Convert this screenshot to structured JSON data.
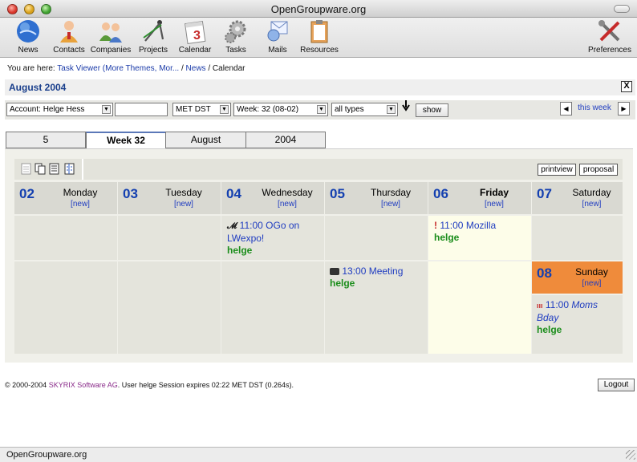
{
  "window": {
    "title": "OpenGroupware.org"
  },
  "toolbar": {
    "items": [
      {
        "label": "News",
        "icon": "news-globe-icon"
      },
      {
        "label": "Contacts",
        "icon": "contacts-person-icon"
      },
      {
        "label": "Companies",
        "icon": "companies-people-icon"
      },
      {
        "label": "Projects",
        "icon": "projects-compass-icon"
      },
      {
        "label": "Calendar",
        "icon": "calendar-icon"
      },
      {
        "label": "Tasks",
        "icon": "tasks-gears-icon"
      },
      {
        "label": "Mails",
        "icon": "mails-envelope-icon"
      },
      {
        "label": "Resources",
        "icon": "resources-clipboard-icon"
      }
    ],
    "preferences": {
      "label": "Preferences",
      "icon": "preferences-tools-icon"
    }
  },
  "breadcrumb": {
    "prefix": "You are here:",
    "link1": "Task Viewer (More Themes, Mor...",
    "sep": "/",
    "link2": "News",
    "current": "Calendar"
  },
  "section": {
    "title": "August 2004",
    "close": "X"
  },
  "filter": {
    "account": "Account: Helge Hess",
    "search_value": "",
    "timezone": "MET DST",
    "week": "Week: 32 (08-02)",
    "types": "all types",
    "show_label": "show",
    "this_week": "this week"
  },
  "tabs": [
    {
      "label": "5",
      "active": false
    },
    {
      "label": "Week 32",
      "active": true
    },
    {
      "label": "August",
      "active": false
    },
    {
      "label": "2004",
      "active": false
    }
  ],
  "view_buttons": {
    "printview": "printview",
    "proposal": "proposal"
  },
  "days": [
    {
      "num": "02",
      "name": "Monday",
      "new": "[new]"
    },
    {
      "num": "03",
      "name": "Tuesday",
      "new": "[new]"
    },
    {
      "num": "04",
      "name": "Wednesday",
      "new": "[new]"
    },
    {
      "num": "05",
      "name": "Thursday",
      "new": "[new]"
    },
    {
      "num": "06",
      "name": "Friday",
      "new": "[new]"
    },
    {
      "num": "07",
      "name": "Saturday",
      "new": "[new]"
    },
    {
      "num": "08",
      "name": "Sunday",
      "new": "[new]"
    }
  ],
  "events": {
    "wed": {
      "line1": "11:00 OGo on",
      "line2": "LWexpo!",
      "who": "helge",
      "icon": "news-m-icon"
    },
    "thu": {
      "line1": "13:00 Meeting",
      "who": "helge",
      "icon": "meeting-camera-icon"
    },
    "fri": {
      "line1": "11:00 Mozilla",
      "who": "helge",
      "icon": "exclamation-icon"
    },
    "sun": {
      "line1": "11:00",
      "line1b": "Moms",
      "line2": "Bday",
      "who": "helge",
      "icon": "birthday-candles-icon"
    }
  },
  "colors": {
    "day_number": "#1440b0",
    "owner": "#1b8d1b",
    "sunday_header": "#ef8b3b",
    "today_cell": "#fdfde9"
  },
  "footer": {
    "copyright_pre": "© 2000-2004",
    "company": "SKYRIX Software AG",
    "session": ". User helge Session expires 02:22 MET DST (0.264s).",
    "logout": "Logout"
  },
  "statusbar": {
    "text": "OpenGroupware.org"
  }
}
